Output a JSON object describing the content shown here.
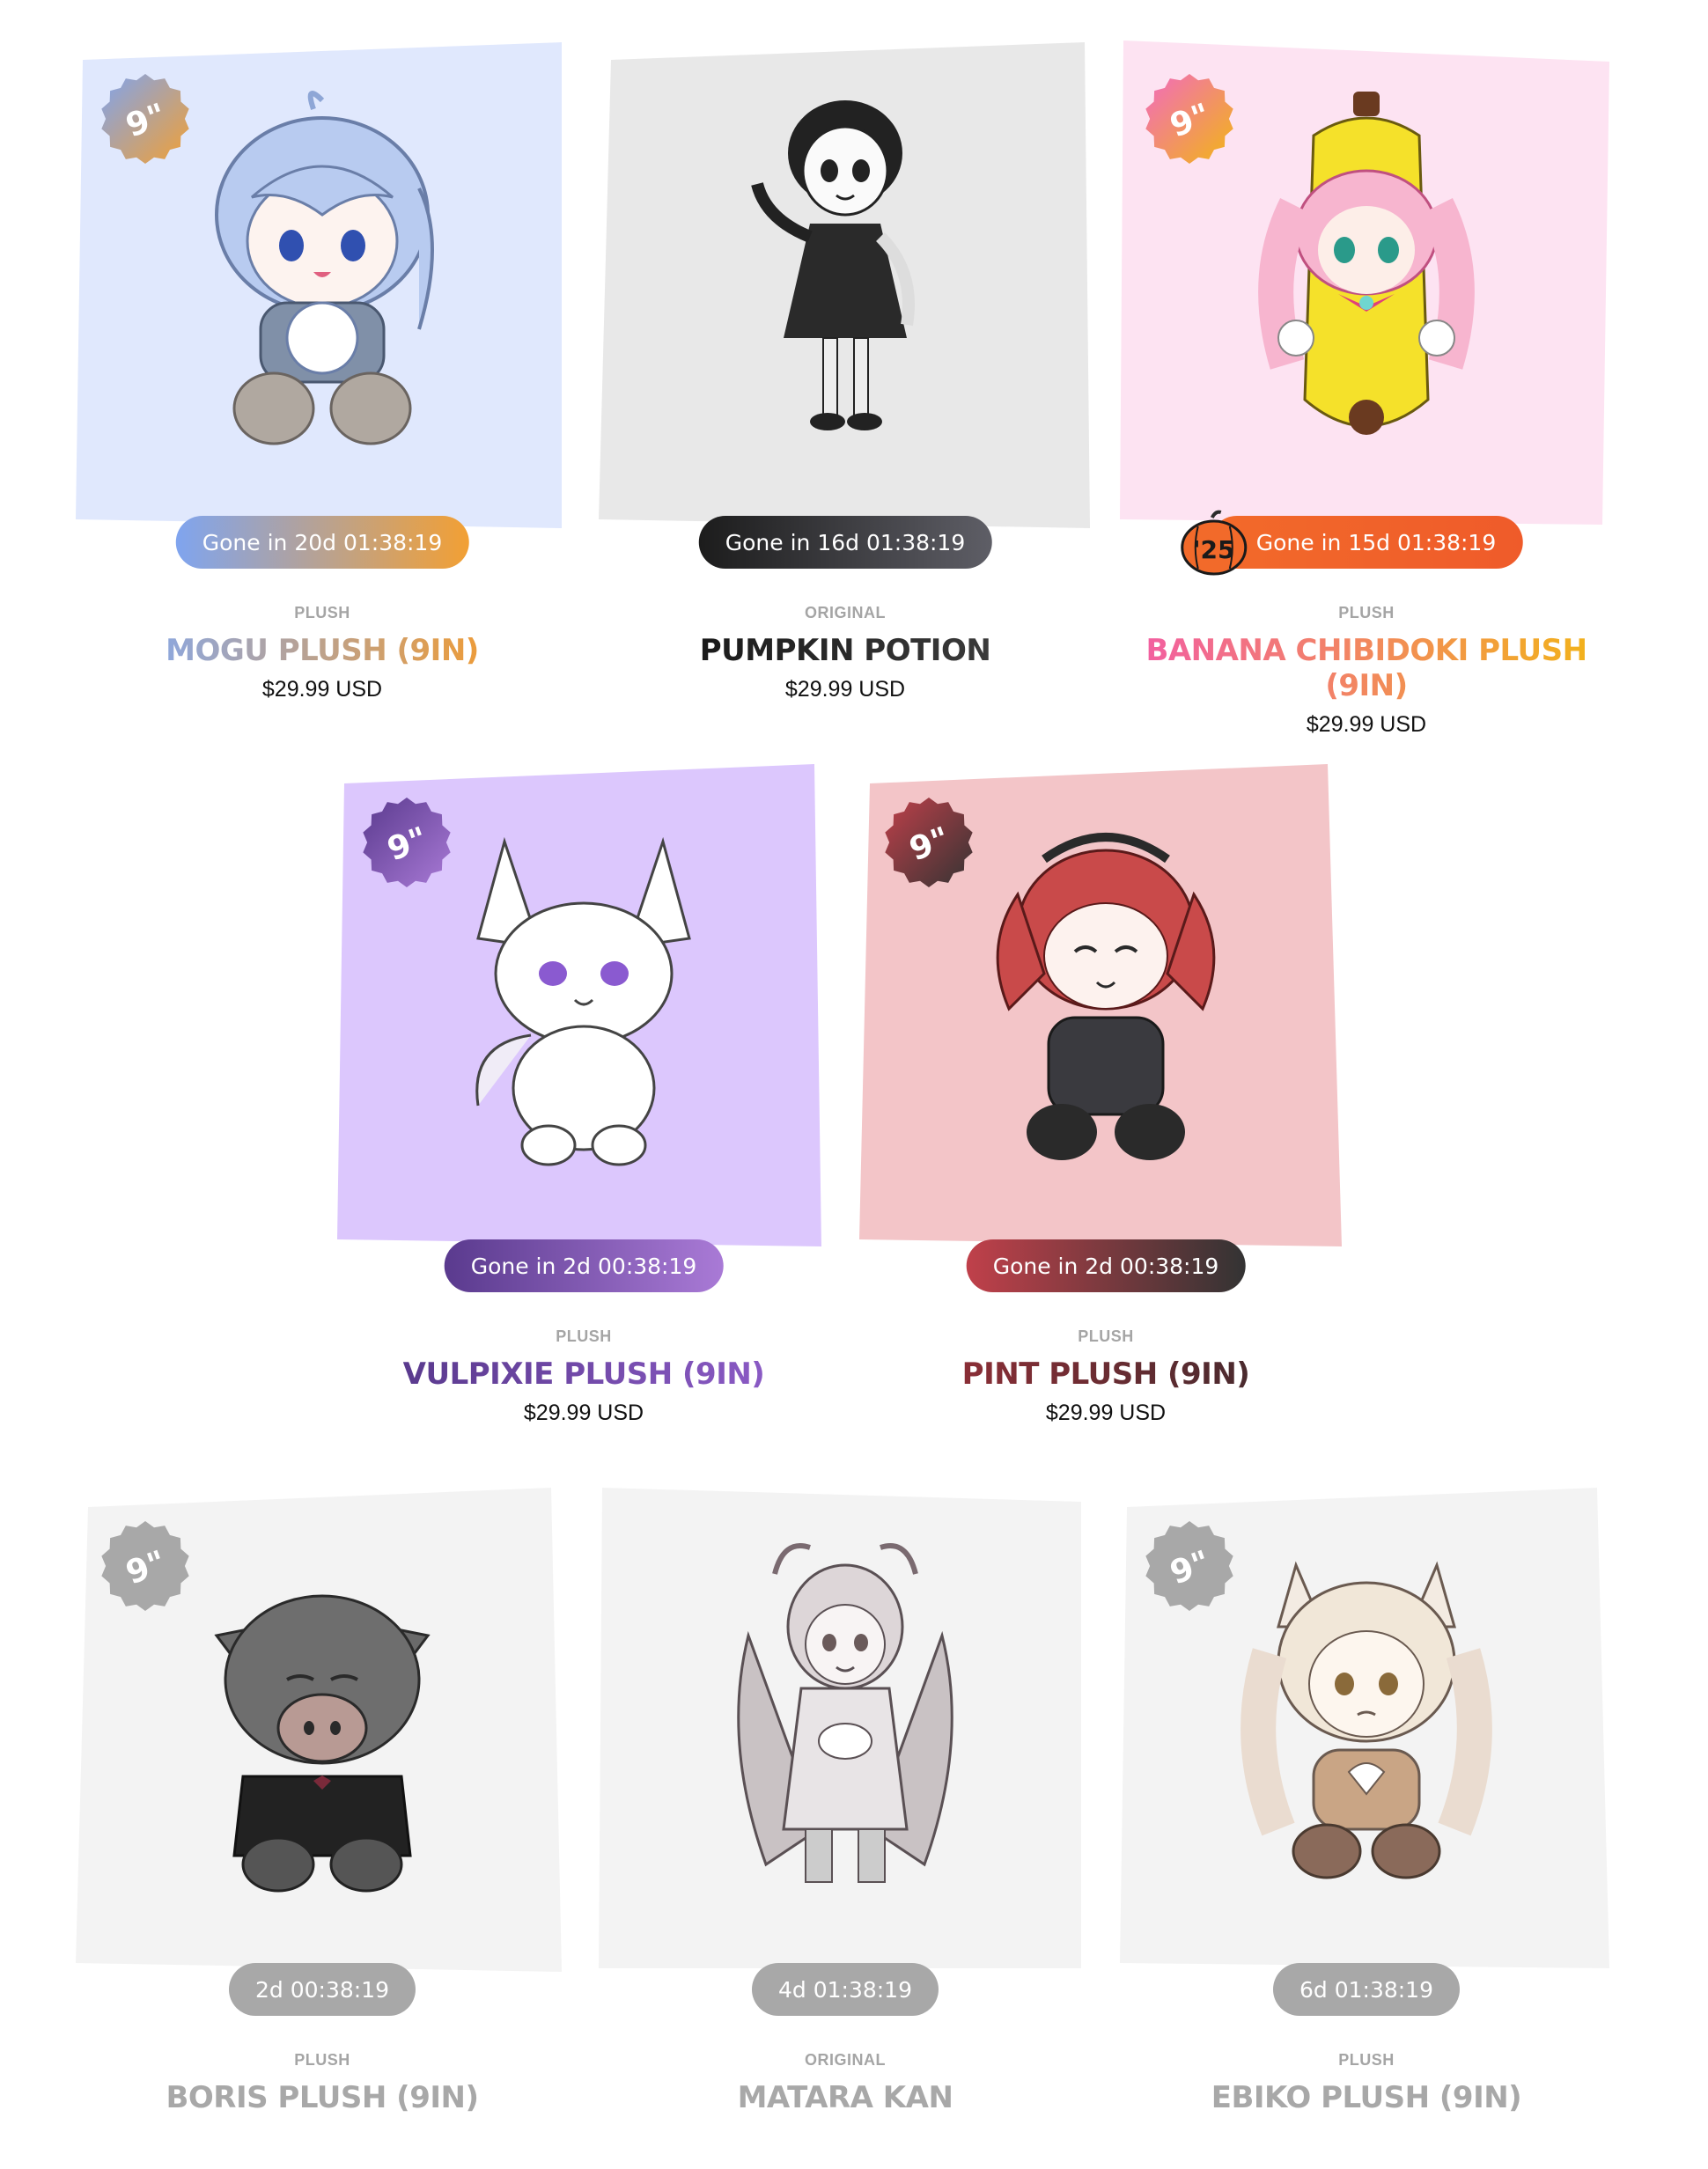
{
  "products": [
    {
      "category": "PLUSH",
      "title": "Mogu Plush (9in)",
      "price": "$29.99 USD",
      "timer": "Gone in 20d 01:38:19",
      "size_badge": "9\"",
      "bg_color": "#e0e8fd",
      "timer_gradient": [
        "#7fa4ef",
        "#f2a034"
      ],
      "title_gradient": [
        "#8fa7db",
        "#ec9c3b"
      ],
      "badge_gradient": [
        "#7fa4ef",
        "#f2a034"
      ],
      "art_icon": "chibi-girl-blue-hair",
      "sold_out": false
    },
    {
      "category": "ORIGINAL",
      "title": "Pumpkin Potion",
      "price": "$29.99 USD",
      "timer": "Gone in 16d 01:38:19",
      "size_badge": "",
      "bg_color": "#e8e8e8",
      "timer_gradient": [
        "#1c1c1c",
        "#5e5e66"
      ],
      "title_gradient": [
        "#1a1a1a",
        "#3a3a3a"
      ],
      "badge_gradient": [
        "#1a1a1a",
        "#3a3a3a"
      ],
      "art_icon": "monochrome-girl-figure",
      "sold_out": false
    },
    {
      "category": "PLUSH",
      "title": "Banana Chibidoki Plush (9in)",
      "price": "$29.99 USD",
      "timer": "Gone in 15d 01:38:19",
      "size_badge": "9\"",
      "bg_color": "#fde3f2",
      "timer_gradient": [
        "#f26a2a",
        "#ef5b2a"
      ],
      "title_gradient": [
        "#f25ba8",
        "#f2b614"
      ],
      "badge_gradient": [
        "#f26ac0",
        "#f2b614"
      ],
      "art_icon": "chibi-banana-girl",
      "halloween_badge": "'25",
      "sold_out": false
    },
    {
      "category": "PLUSH",
      "title": "Vulpixie Plush (9in)",
      "price": "$29.99 USD",
      "timer": "Gone in 2d 00:38:19",
      "size_badge": "9\"",
      "bg_color": "#dcc7fd",
      "timer_gradient": [
        "#5a3a8e",
        "#a97ad6"
      ],
      "title_gradient": [
        "#5a3a8e",
        "#8a5ac4"
      ],
      "badge_gradient": [
        "#5a3a8e",
        "#a97ad6"
      ],
      "art_icon": "white-fox-plush",
      "sold_out": false
    },
    {
      "category": "PLUSH",
      "title": "Pint Plush (9in)",
      "price": "$29.99 USD",
      "timer": "Gone in 2d 00:38:19",
      "size_badge": "9\"",
      "bg_color": "#f3c5c8",
      "timer_gradient": [
        "#c0404a",
        "#333333"
      ],
      "title_gradient": [
        "#8a2e36",
        "#4a2a2e"
      ],
      "badge_gradient": [
        "#c0404a",
        "#333333"
      ],
      "art_icon": "red-hair-girl-plush",
      "sold_out": false
    },
    {
      "category": "PLUSH",
      "title": "Boris Plush (9in)",
      "price": "",
      "timer": "2d 00:38:19",
      "size_badge": "9\"",
      "bg_color": "#f3f3f3",
      "timer_gradient": [
        "#a8a8a8",
        "#a8a8a8"
      ],
      "title_gradient": [
        "#a8a8a8",
        "#a8a8a8"
      ],
      "badge_gradient": [
        "#a8a8a8",
        "#a8a8a8"
      ],
      "art_icon": "boar-plush",
      "sold_out": true
    },
    {
      "category": "ORIGINAL",
      "title": "Matara Kan",
      "price": "",
      "timer": "4d 01:38:19",
      "size_badge": "",
      "bg_color": "#f3f3f3",
      "timer_gradient": [
        "#a8a8a8",
        "#a8a8a8"
      ],
      "title_gradient": [
        "#a8a8a8",
        "#a8a8a8"
      ],
      "badge_gradient": [
        "#a8a8a8",
        "#a8a8a8"
      ],
      "art_icon": "winged-girl-figure",
      "sold_out": true
    },
    {
      "category": "PLUSH",
      "title": "Ebiko Plush (9in)",
      "price": "",
      "timer": "6d 01:38:19",
      "size_badge": "9\"",
      "bg_color": "#f3f3f3",
      "timer_gradient": [
        "#a8a8a8",
        "#a8a8a8"
      ],
      "title_gradient": [
        "#a8a8a8",
        "#a8a8a8"
      ],
      "badge_gradient": [
        "#a8a8a8",
        "#a8a8a8"
      ],
      "art_icon": "cat-ear-girl-plush",
      "sold_out": true
    }
  ]
}
